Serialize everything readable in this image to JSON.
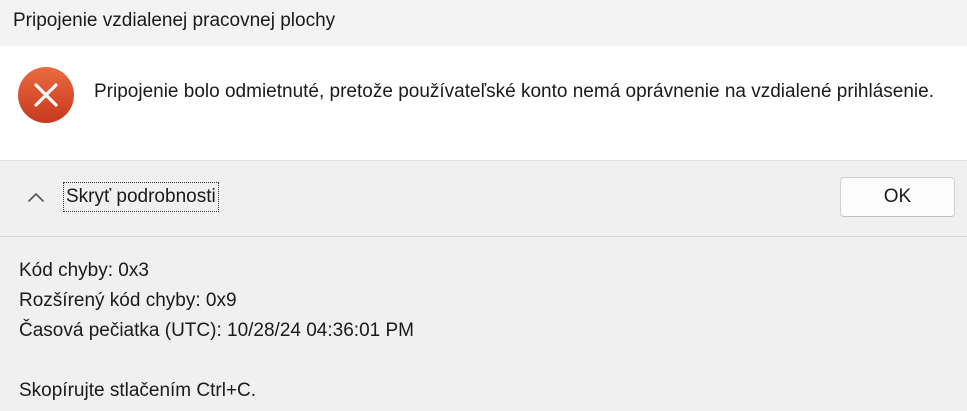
{
  "window": {
    "title": "Pripojenie vzdialenej pracovnej plochy"
  },
  "dialog": {
    "icon": "error-icon",
    "message": "Pripojenie bolo odmietnuté, pretože používateľské konto nemá oprávnenie na vzdialené prihlásenie.",
    "toggle_label": "Skryť podrobnosti",
    "ok_label": "OK"
  },
  "details": {
    "error_code": "Kód chyby: 0x3",
    "extended_error_code": "Rozšírený kód chyby: 0x9",
    "timestamp": "Časová pečiatka (UTC): 10/28/24 04:36:01 PM",
    "copy_hint": "Skopírujte stlačením Ctrl+C."
  },
  "colors": {
    "error_red": "#e0502e",
    "content_bg": "#ffffff",
    "dialog_bg": "#f0f0f0"
  }
}
